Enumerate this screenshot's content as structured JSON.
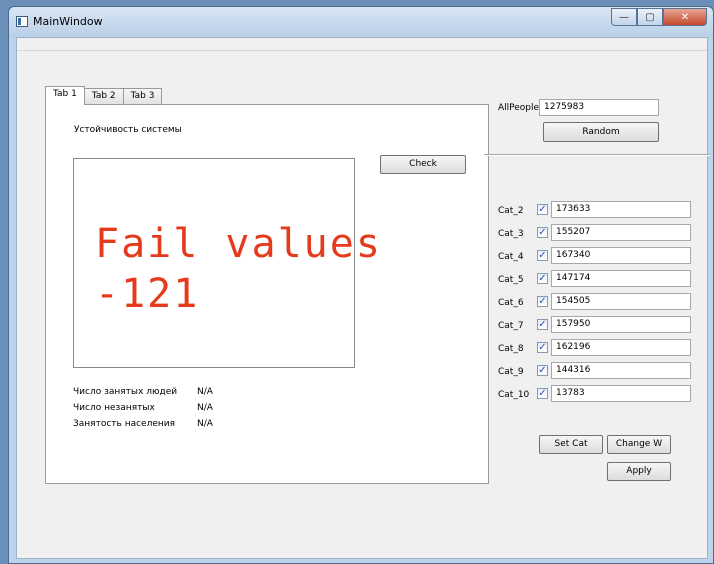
{
  "window": {
    "title": "MainWindow"
  },
  "caption_buttons": {
    "minimize": "—",
    "maximize": "▢",
    "close": "✕"
  },
  "tabs": [
    {
      "label": "Tab 1"
    },
    {
      "label": "Tab 2"
    },
    {
      "label": "Tab 3"
    }
  ],
  "tab1": {
    "system_stability_label": "Устойчивость системы",
    "check_label": "Check",
    "display_line1": "Fail values",
    "display_line2": "-121",
    "stats": [
      {
        "label": "Число занятых людей",
        "value": "N/A"
      },
      {
        "label": "Число незанятых",
        "value": "N/A"
      },
      {
        "label": "Занятость населения",
        "value": "N/A"
      }
    ]
  },
  "right_panel": {
    "allpeople_label": "AllPeople",
    "allpeople_value": "1275983",
    "random_label": "Random",
    "categories": [
      {
        "label": "Cat_2",
        "checked": true,
        "value": "173633"
      },
      {
        "label": "Cat_3",
        "checked": true,
        "value": "155207"
      },
      {
        "label": "Cat_4",
        "checked": true,
        "value": "167340"
      },
      {
        "label": "Cat_5",
        "checked": true,
        "value": "147174"
      },
      {
        "label": "Cat_6",
        "checked": true,
        "value": "154505"
      },
      {
        "label": "Cat_7",
        "checked": true,
        "value": "157950"
      },
      {
        "label": "Cat_8",
        "checked": true,
        "value": "162196"
      },
      {
        "label": "Cat_9",
        "checked": true,
        "value": "144316"
      },
      {
        "label": "Cat_10",
        "checked": true,
        "value": "13783"
      }
    ],
    "set_cat_label": "Set Cat",
    "change_w_label": "Change W",
    "apply_label": "Apply"
  },
  "colors": {
    "fail_text": "#e53a1c",
    "titlebar": "#c9dcf0",
    "close_button": "#c34a2c"
  }
}
